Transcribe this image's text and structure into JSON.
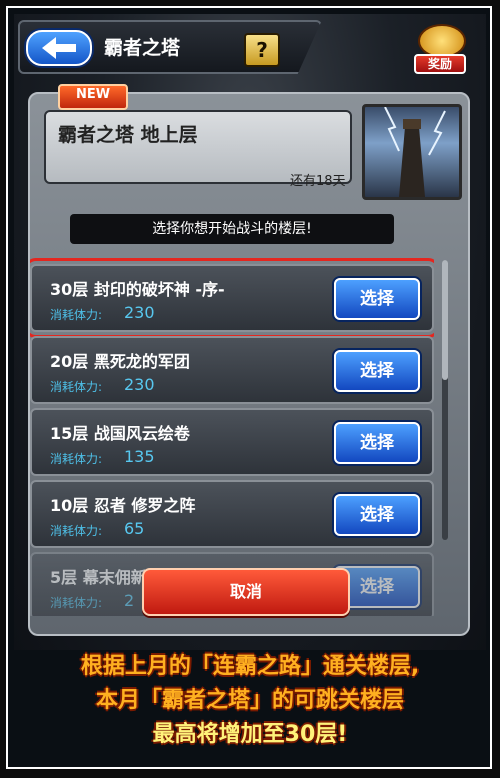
{
  "header": {
    "title": "霸者之塔",
    "help_label": "?",
    "reward_label": "奖励"
  },
  "floor_card": {
    "badge": "NEW",
    "name": "霸者之塔 地上层",
    "remaining": "还有18天"
  },
  "instruction": "选择你想开始战斗的楼层!",
  "floors": [
    {
      "name": "30层 封印的破坏神 -序-",
      "cost_label": "消耗体力:",
      "cost": "230",
      "button": "选择"
    },
    {
      "name": "20层 黑死龙的军团",
      "cost_label": "消耗体力:",
      "cost": "230",
      "button": "选择"
    },
    {
      "name": "15层 战国风云绘卷",
      "cost_label": "消耗体力:",
      "cost": "135",
      "button": "选择"
    },
    {
      "name": "10层 忍者 修罗之阵",
      "cost_label": "消耗体力:",
      "cost": "65",
      "button": "选择"
    },
    {
      "name": "5层 幕末佣新编",
      "cost_label": "消耗体力:",
      "cost": "2",
      "button": "选择"
    }
  ],
  "cancel_label": "取消",
  "caption": {
    "line1": "根据上月的「连霸之路」通关楼层,",
    "line2": "本月「霸者之塔」的可跳关楼层",
    "line3": "最高将增加至30层!"
  },
  "colors": {
    "accent_blue": "#1a5fd6",
    "cancel_red": "#d62a1a",
    "caption_orange": "#ffb020"
  }
}
